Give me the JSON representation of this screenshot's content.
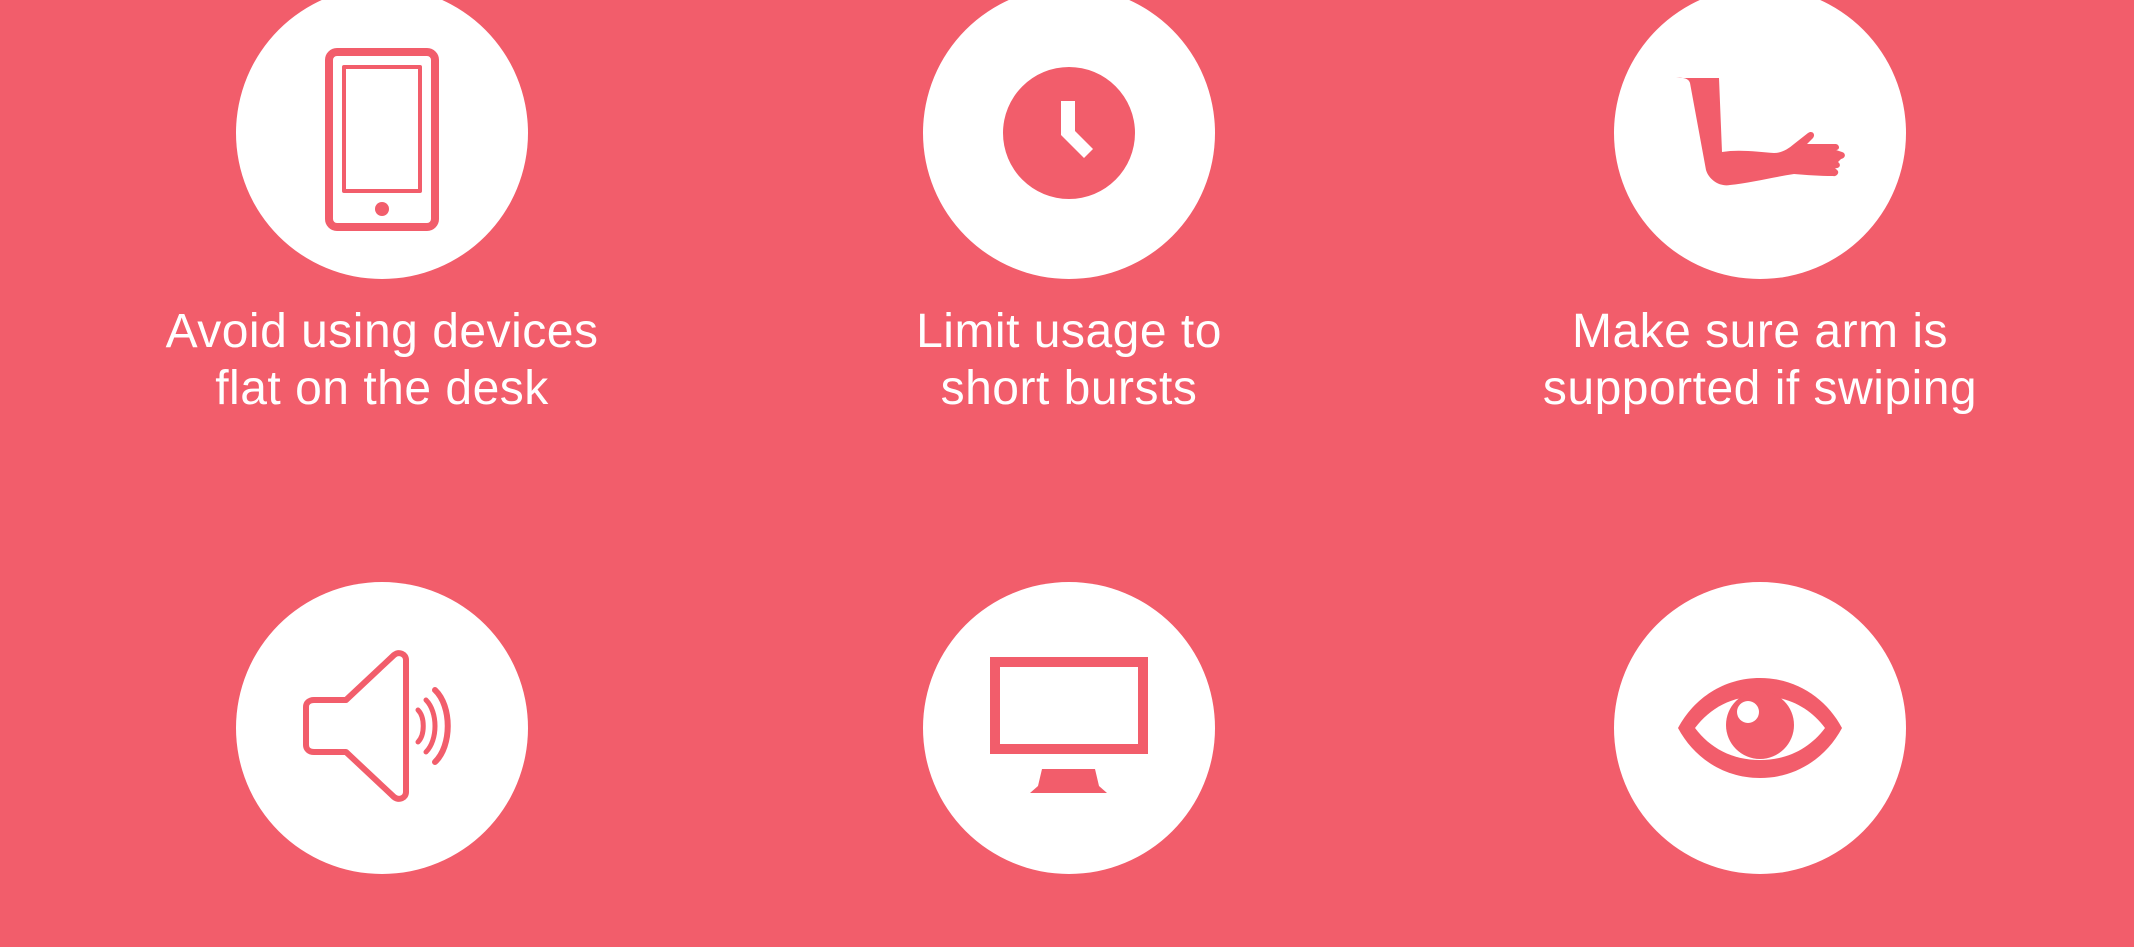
{
  "colors": {
    "background": "#f25d6b",
    "circle": "#ffffff",
    "icon": "#f25d6b",
    "text": "#ffffff"
  },
  "tips": [
    {
      "icon": "phone-icon",
      "line1": "Avoid using devices",
      "line2": "flat on the desk"
    },
    {
      "icon": "clock-icon",
      "line1": "Limit usage to",
      "line2": "short bursts"
    },
    {
      "icon": "arm-icon",
      "line1": "Make sure arm is",
      "line2": "supported if swiping"
    },
    {
      "icon": "speaker-icon",
      "line1": "",
      "line2": ""
    },
    {
      "icon": "monitor-icon",
      "line1": "",
      "line2": ""
    },
    {
      "icon": "eye-icon",
      "line1": "",
      "line2": ""
    }
  ]
}
